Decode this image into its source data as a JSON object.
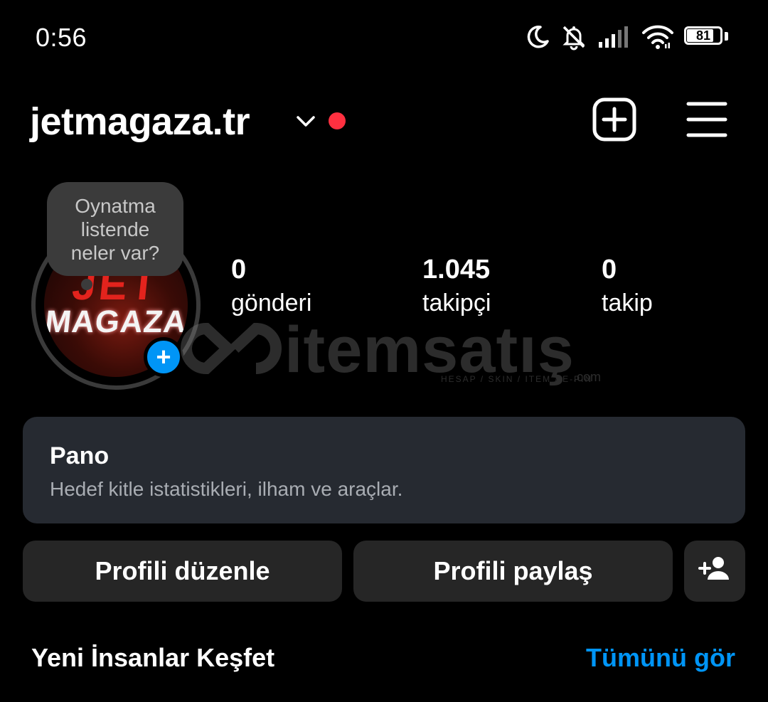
{
  "status_bar": {
    "time": "0:56",
    "battery": "81",
    "battery_level": 0.81,
    "icons": [
      "moon-icon",
      "bell-muted-icon",
      "signal-icon",
      "wifi-icon",
      "battery-icon"
    ]
  },
  "header": {
    "username": "jetmagaza.tr",
    "dropdown_icon": "chevron-down-icon",
    "notification_dot_color": "#ff3040",
    "new_post_icon": "plus-square-icon",
    "menu_icon": "hamburger-menu-icon"
  },
  "profile": {
    "avatar_text_line1": "JET",
    "avatar_text_line2": "MAGAZA",
    "note": "Oynatma\nlistende\nneler var?",
    "stats": [
      {
        "value": "0",
        "label": "gönderi"
      },
      {
        "value": "1.045",
        "label": "takipçi"
      },
      {
        "value": "0",
        "label": "takip"
      }
    ]
  },
  "watermark": {
    "text": "itemsatış",
    "sub": "HESAP / SKIN / ITEM / E-PIN",
    "suffix": ".com"
  },
  "dashboard": {
    "title": "Pano",
    "subtitle": "Hedef kitle istatistikleri, ilham ve araçlar."
  },
  "actions": {
    "edit_label": "Profili düzenle",
    "share_label": "Profili paylaş",
    "add_user_icon": "add-user-icon"
  },
  "discover": {
    "title": "Yeni İnsanlar Keşfet",
    "see_all": "Tümünü gör"
  },
  "colors": {
    "background": "#000000",
    "card": "#262a31",
    "button": "#262626",
    "accent_blue": "#0095f6",
    "red_dot": "#ff3040"
  }
}
